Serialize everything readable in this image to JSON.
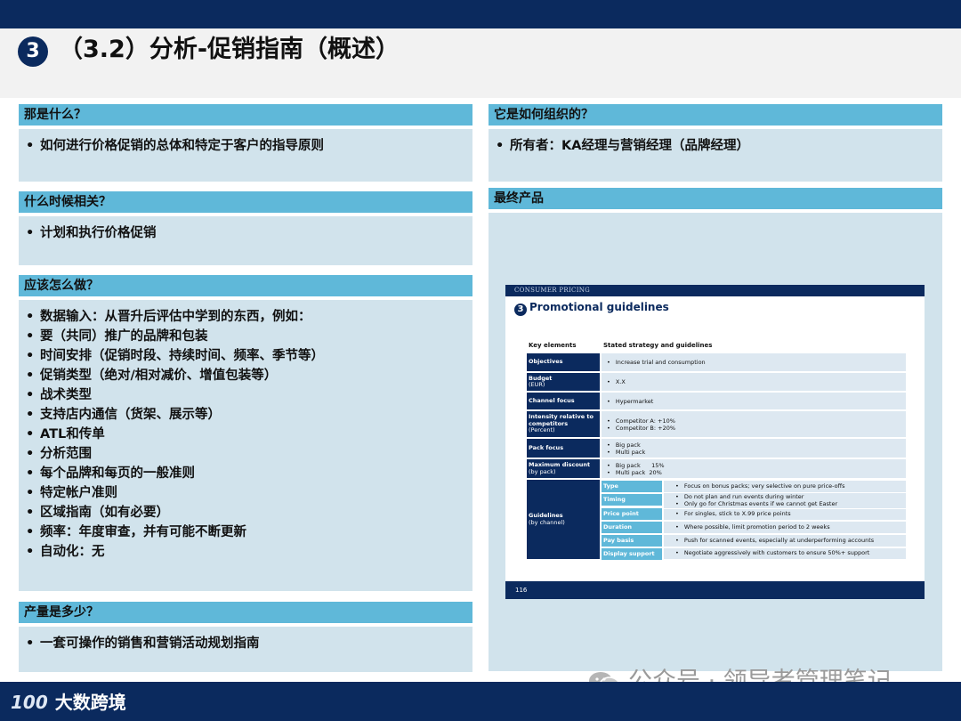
{
  "title": {
    "number": "3",
    "text": "（3.2）分析-促销指南（概述）"
  },
  "sections": {
    "what": {
      "header": "那是什么？",
      "bullets": [
        "如何进行价格促销的总体和特定于客户的指导原则"
      ]
    },
    "when": {
      "header": "什么时候相关？",
      "bullets": [
        "计划和执行价格促销"
      ]
    },
    "how": {
      "header": "应该怎么做？",
      "bullets": [
        "数据输入：从晋升后评估中学到的东西，例如：",
        "要（共同）推广的品牌和包装",
        "时间安排（促销时段、持续时间、频率、季节等）",
        "促销类型（绝对/相对减价、增值包装等）",
        "战术类型",
        "支持店内通信（货架、展示等）",
        "ATL和传单",
        "分析范围",
        "每个品牌和每页的一般准则",
        "特定帐户准则",
        "区域指南（如有必要）",
        "频率：年度审查，并有可能不断更新",
        "自动化：无"
      ]
    },
    "output": {
      "header": "产量是多少？",
      "bullets": [
        "一套可操作的销售和营销活动规划指南"
      ]
    },
    "org": {
      "header": "它是如何组织的？",
      "bullets": [
        "所有者：KA经理与营销经理（品牌经理）"
      ]
    },
    "final": {
      "header": "最终产品"
    }
  },
  "slide": {
    "top_label": "CONSUMER PRICING",
    "title_num": "3",
    "title": "Promotional guidelines",
    "col_key": "Key elements",
    "col_strategy": "Stated strategy and guidelines",
    "rows": [
      {
        "key": "Objectives",
        "sub": "",
        "values": [
          "Increase trial and consumption"
        ]
      },
      {
        "key": "Budget",
        "sub": "(EUR)",
        "values": [
          "X.X"
        ]
      },
      {
        "key": "Channel focus",
        "sub": "",
        "values": [
          "Hypermarket"
        ]
      },
      {
        "key": "Intensity relative to competitors",
        "sub": "(Percent)",
        "values": [
          "Competitor A: +10%",
          "Competitor B: +20%"
        ]
      },
      {
        "key": "Pack focus",
        "sub": "",
        "values": [
          "Big pack",
          "Multi pack"
        ]
      },
      {
        "key": "Maximum discount",
        "sub": "(by pack)",
        "values": [
          "Big pack      15%",
          "Multi pack  20%"
        ]
      }
    ],
    "guidelines": {
      "key": "Guidelines",
      "sub": "(by channel)",
      "items": [
        {
          "label": "Type",
          "values": [
            "Focus on bonus packs; very selective on pure price-offs"
          ]
        },
        {
          "label": "Timing",
          "values": [
            "Do not plan and run events during winter",
            "Only go for Christmas events if we cannot get Easter"
          ]
        },
        {
          "label": "Price point",
          "values": [
            "For singles, stick to X.99 price points"
          ]
        },
        {
          "label": "Duration",
          "values": [
            "Where possible, limit promotion period to 2 weeks"
          ]
        },
        {
          "label": "Pay basis",
          "values": [
            "Push for scanned events, especially at underperforming accounts"
          ]
        },
        {
          "label": "Display support",
          "values": [
            "Negotiate aggressively with customers to ensure 50%+ support"
          ]
        }
      ]
    },
    "page_number": "116"
  },
  "footer": {
    "logo": "100",
    "brand": "大数跨境"
  },
  "watermark": "公众号 · 领导者管理笔记",
  "colors": {
    "navy": "#0b2a5e",
    "header_blue": "#5fb8d9",
    "box_blue": "#d1e3ec"
  }
}
